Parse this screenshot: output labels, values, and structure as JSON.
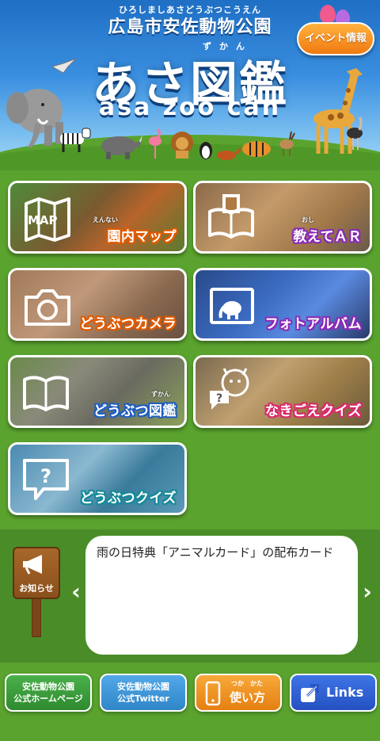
{
  "header": {
    "kana": "ひろしましあさどうぶつこうえん",
    "subtitle": "広島市安佐動物公園",
    "title": "あさ図鑑",
    "title_ruby": "ずかん",
    "latin_title": "asa zoo can",
    "event_button": "イベント情報"
  },
  "menu": {
    "map": {
      "label": "園内マップ",
      "ruby": "えんない",
      "icon_text": "MAP",
      "icon": "map-icon"
    },
    "ar": {
      "label": "教えてＡＲ",
      "ruby": "おし",
      "icon": "book-ar-icon"
    },
    "camera": {
      "label": "どうぶつカメラ",
      "icon": "camera-icon"
    },
    "album": {
      "label": "フォトアルバム",
      "icon": "photo-album-icon"
    },
    "zukan": {
      "label": "どうぶつ図鑑",
      "ruby": "ずかん",
      "icon": "open-book-icon"
    },
    "voice_quiz": {
      "label": "なきごえクイズ",
      "icon": "tiger-speech-icon"
    },
    "quiz": {
      "label": "どうぶつクイズ",
      "icon": "question-bubble-icon"
    }
  },
  "notice": {
    "sign_label": "お知らせ",
    "text": "雨の日特典「アニマルカード」の配布カード",
    "prev": "‹",
    "next": "›"
  },
  "footer": {
    "homepage": {
      "line1": "安佐動物公園",
      "line2": "公式ホームページ"
    },
    "twitter": {
      "line1": "安佐動物公園",
      "line2": "公式Twitter"
    },
    "howto": {
      "label": "使い方",
      "ruby": "つか　かた"
    },
    "links": {
      "label": "Links"
    }
  },
  "colors": {
    "bg_green": "#5aa32e",
    "header_blue": "#1f6fc4",
    "event_orange": "#f07a10",
    "homepage_green": "#3a9b3a",
    "twitter_blue": "#3d97d8",
    "howto_orange": "#f0931e",
    "links_blue": "#2c5fd4"
  }
}
